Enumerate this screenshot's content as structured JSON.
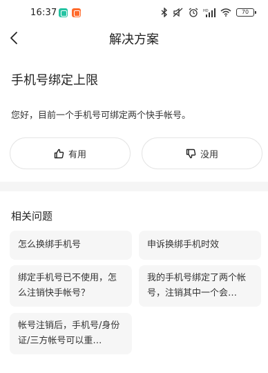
{
  "status_bar": {
    "time": "16:37",
    "battery": "70",
    "icons": [
      "bluetooth-icon",
      "mute-icon",
      "alarm-icon",
      "signal-icon",
      "wifi-icon",
      "battery-icon"
    ]
  },
  "nav": {
    "back_icon": "chevron-left-icon",
    "title": "解决方案"
  },
  "article": {
    "title": "手机号绑定上限",
    "body": "您好，目前一个手机号可绑定两个快手帐号。"
  },
  "feedback": {
    "useful_label": "有用",
    "useless_label": "没用"
  },
  "related": {
    "title": "相关问题",
    "items": [
      {
        "label": "怎么换绑手机号"
      },
      {
        "label": "申诉换绑手机时效"
      },
      {
        "label": "绑定手机号已不使用，怎么注销快手帐号？"
      },
      {
        "label": "我的手机号绑定了两个帐号，注销其中一个会…"
      },
      {
        "label": "帐号注销后，手机号/身份证/三方帐号可以重…"
      }
    ]
  }
}
